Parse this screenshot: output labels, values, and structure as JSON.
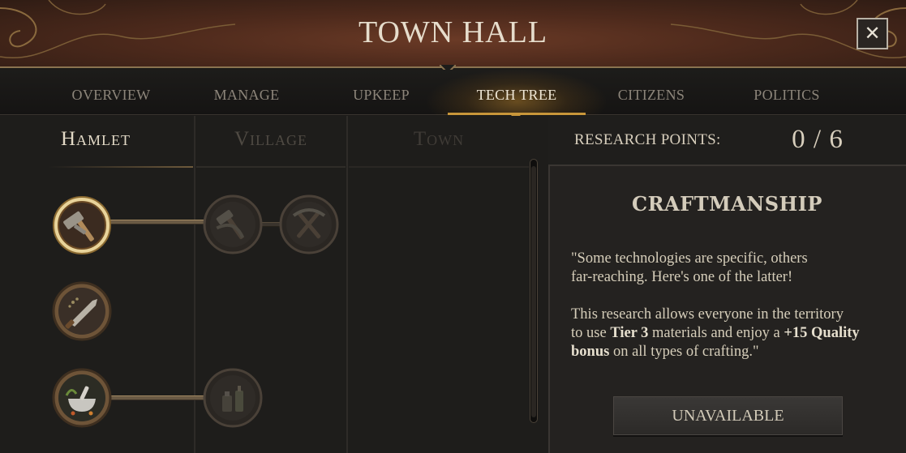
{
  "window": {
    "title": "TOWN HALL",
    "close_label": "✕"
  },
  "tabs": [
    {
      "label": "OVERVIEW",
      "active": false
    },
    {
      "label": "MANAGE",
      "active": false
    },
    {
      "label": "UPKEEP",
      "active": false
    },
    {
      "label": "TECH TREE",
      "active": true
    },
    {
      "label": "CITIZENS",
      "active": false
    },
    {
      "label": "POLITICS",
      "active": false
    }
  ],
  "tiers": [
    {
      "label": "Hamlet",
      "unlocked": true
    },
    {
      "label": "Village",
      "unlocked": false
    },
    {
      "label": "Town",
      "unlocked": false
    }
  ],
  "tree_nodes": [
    {
      "icon": "hammer-icon",
      "tier": "Hamlet",
      "state": "selected"
    },
    {
      "icon": "hammer-pick-icon",
      "tier": "Village",
      "state": "locked"
    },
    {
      "icon": "pick-icon",
      "tier": "Village",
      "state": "locked"
    },
    {
      "icon": "knife-seeds-icon",
      "tier": "Hamlet",
      "state": "available"
    },
    {
      "icon": "mortar-herbs-icon",
      "tier": "Hamlet",
      "state": "available"
    },
    {
      "icon": "potion-bottles-icon",
      "tier": "Village",
      "state": "locked"
    }
  ],
  "research": {
    "label": "RESEARCH POINTS:",
    "value": "0 / 6"
  },
  "tech": {
    "name": "CRAFTMANSHIP",
    "quote_line1": "\"Some technologies are specific, others",
    "quote_line2": "far-reaching. Here's one of the latter!",
    "body_line1": "This research allows everyone in the territory",
    "body_line2_a": "to use ",
    "body_line2_b": "Tier 3",
    "body_line2_c": " materials and enjoy a ",
    "body_line2_d": "+15 Quality",
    "body_line3_a": "bonus",
    "body_line3_b": " on all types of crafting.\"",
    "button_label": "UNAVAILABLE"
  },
  "colors": {
    "accent_gold": "#c8963a",
    "title_bar": "#5a3020",
    "panel_bg": "#242220"
  }
}
